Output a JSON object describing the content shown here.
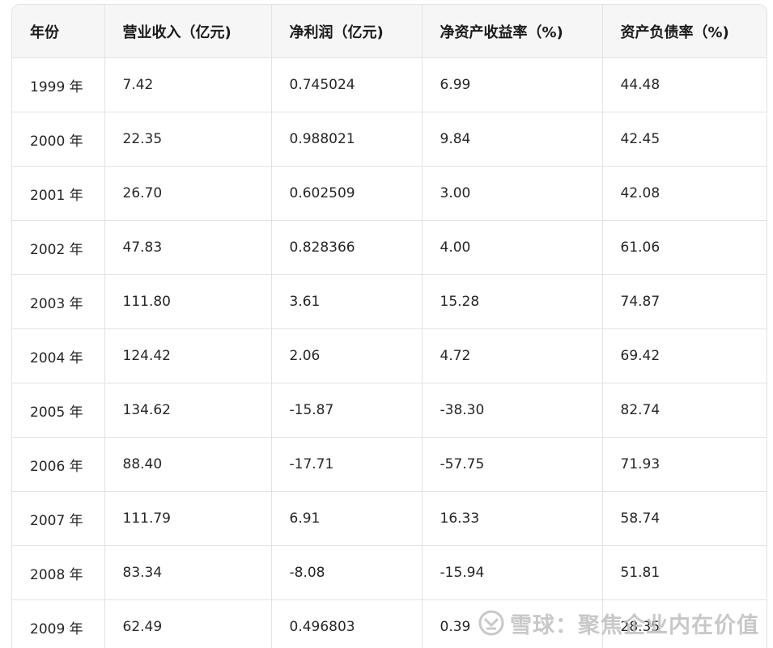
{
  "table": {
    "headers": [
      "年份",
      "营业收入（亿元)",
      "净利润（亿元)",
      "净资产收益率（%)",
      "资产负债率（%)"
    ],
    "rows": [
      [
        "1999 年",
        "7.42",
        "0.745024",
        "6.99",
        "44.48"
      ],
      [
        "2000 年",
        "22.35",
        "0.988021",
        "9.84",
        "42.45"
      ],
      [
        "2001 年",
        "26.70",
        "0.602509",
        "3.00",
        "42.08"
      ],
      [
        "2002 年",
        "47.83",
        "0.828366",
        "4.00",
        "61.06"
      ],
      [
        "2003 年",
        "111.80",
        "3.61",
        "15.28",
        "74.87"
      ],
      [
        "2004 年",
        "124.42",
        "2.06",
        "4.72",
        "69.42"
      ],
      [
        "2005 年",
        "134.62",
        "-15.87",
        "-38.30",
        "82.74"
      ],
      [
        "2006 年",
        "88.40",
        "-17.71",
        "-57.75",
        "71.93"
      ],
      [
        "2007 年",
        "111.79",
        "6.91",
        "16.33",
        "58.74"
      ],
      [
        "2008 年",
        "83.34",
        "-8.08",
        "-15.94",
        "51.81"
      ],
      [
        "2009 年",
        "62.49",
        "0.496803",
        "0.39",
        "28.35"
      ]
    ]
  },
  "watermark": {
    "text": "雪球：聚焦企业内在价值",
    "icon": "snowball-logo-icon"
  }
}
